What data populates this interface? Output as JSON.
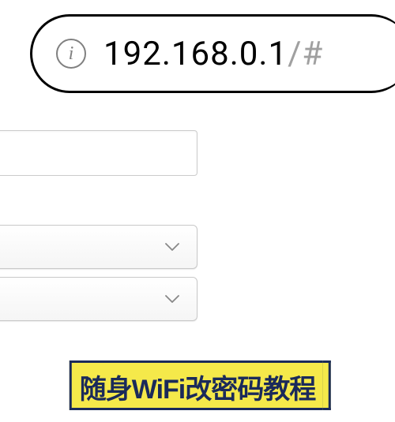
{
  "browser": {
    "url_main": "192.168.0.1",
    "url_path": "/#",
    "info_icon_label": "i"
  },
  "form": {
    "text_field_value": "",
    "dropdown1_value": "",
    "dropdown2_value": ""
  },
  "caption": {
    "text": "随身WiFi改密码教程"
  }
}
